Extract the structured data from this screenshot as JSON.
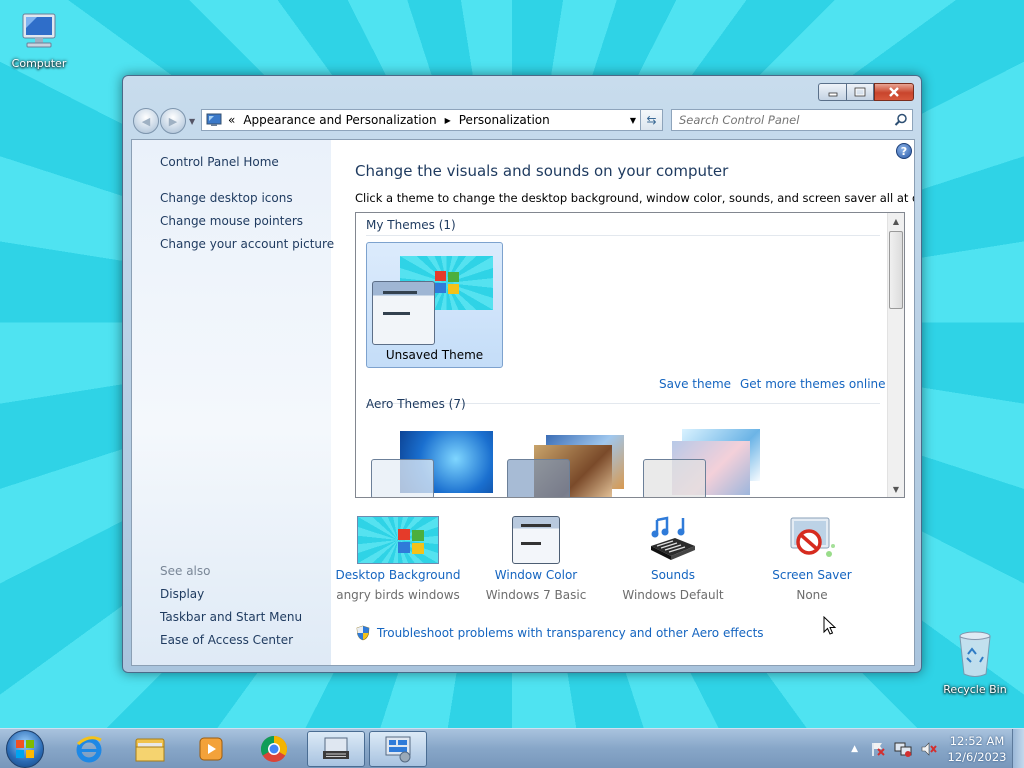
{
  "desktop": {
    "icons": [
      {
        "label": "Computer"
      },
      {
        "label": "Recycle Bin"
      }
    ]
  },
  "window": {
    "address_prefix": "«",
    "breadcrumb": [
      "Appearance and Personalization",
      "Personalization"
    ],
    "search_placeholder": "Search Control Panel",
    "help_label": "?",
    "left_nav": {
      "home": "Control Panel Home",
      "links": [
        "Change desktop icons",
        "Change mouse pointers",
        "Change your account picture"
      ],
      "see_also_title": "See also",
      "see_also": [
        "Display",
        "Taskbar and Start Menu",
        "Ease of Access Center"
      ]
    },
    "main": {
      "title": "Change the visuals and sounds on your computer",
      "description": "Click a theme to change the desktop background, window color, sounds, and screen saver all at once.",
      "my_themes_header": "My Themes (1)",
      "unsaved_theme": "Unsaved Theme",
      "save_theme": "Save theme",
      "get_more": "Get more themes online",
      "aero_header": "Aero Themes (7)",
      "settings": [
        {
          "name": "Desktop Background",
          "value": "angry birds windows",
          "icon": "desktop-background-icon"
        },
        {
          "name": "Window Color",
          "value": "Windows 7 Basic",
          "icon": "window-color-icon"
        },
        {
          "name": "Sounds",
          "value": "Windows Default",
          "icon": "sounds-icon"
        },
        {
          "name": "Screen Saver",
          "value": "None",
          "icon": "screen-saver-icon"
        }
      ],
      "troubleshoot": "Troubleshoot problems with transparency and other Aero effects"
    }
  },
  "taskbar": {
    "time": "12:52 AM",
    "date": "12/6/2023",
    "tray_arrow": "▲"
  },
  "colors": {
    "link": "#1565c0",
    "heading": "#1e3a5f",
    "desktop": "#2fd3e6"
  }
}
